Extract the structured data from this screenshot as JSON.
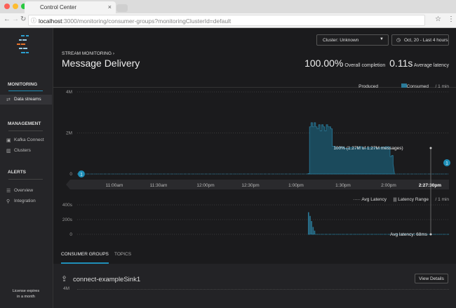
{
  "browser": {
    "tab_title": "Control Center",
    "url_host": "localhost",
    "url_rest": ":3000/monitoring/consumer-groups?monitoringClusterId=default"
  },
  "sidebar": {
    "sections": [
      {
        "title": "MONITORING",
        "items": [
          {
            "label": "Data streams",
            "icon": "data-streams-icon",
            "active": true
          }
        ]
      },
      {
        "title": "MANAGEMENT",
        "items": [
          {
            "label": "Kafka Connect",
            "icon": "kafka-connect-icon"
          },
          {
            "label": "Clusters",
            "icon": "clusters-icon"
          }
        ]
      },
      {
        "title": "ALERTS",
        "items": [
          {
            "label": "Overview",
            "icon": "list-icon"
          },
          {
            "label": "Integration",
            "icon": "integration-icon"
          }
        ]
      }
    ],
    "license_line1": "License expires",
    "license_line2": "in a month"
  },
  "header": {
    "cluster_select": "Cluster: Unknown",
    "time_range": "Oct, 20 - Last 4 hours",
    "breadcrumb": "STREAM MONITORING",
    "title": "Message Delivery",
    "completion_value": "100.00%",
    "completion_label": "Overall completion",
    "latency_value": "0.11s",
    "latency_label": "Average latency"
  },
  "colors": {
    "accent": "#1f8fb8",
    "area": "#1b4a5c",
    "sidebar": "#252528",
    "bg": "#1b1b1d"
  },
  "chart_data": [
    {
      "type": "area",
      "legend": [
        "Produced",
        "Consumed"
      ],
      "interval": "/ 1 min",
      "yticks": [
        "4M",
        "2M",
        "0"
      ],
      "ylim": [
        0,
        4000000
      ],
      "xticks": [
        "11:00am",
        "11:30am",
        "12:00pm",
        "12:30pm",
        "1:00pm",
        "1:30pm",
        "2:00pm",
        "2:27:30pm"
      ],
      "annotation": "100% (1.27M of 1.27M messages)",
      "markers": [
        "1",
        "1"
      ],
      "x": [
        "13:42",
        "13:43",
        "13:44",
        "13:45",
        "13:46",
        "13:47",
        "13:48",
        "13:49",
        "13:50",
        "13:51",
        "13:52",
        "13:53",
        "13:54",
        "13:55",
        "13:56",
        "13:57",
        "13:58",
        "14:00",
        "14:03",
        "14:06",
        "14:09",
        "14:12",
        "14:15",
        "14:18",
        "14:21",
        "14:24",
        "14:27",
        "14:30",
        "14:33",
        "14:35",
        "14:36",
        "14:37",
        "14:38"
      ],
      "consumed": [
        20000,
        2300000,
        2500000,
        2300000,
        2500000,
        2300000,
        2200000,
        2400000,
        2100000,
        2400000,
        2300000,
        2100000,
        2400000,
        2300000,
        2300000,
        2200000,
        1350000,
        1280000,
        1320000,
        1250000,
        1300000,
        1270000,
        1330000,
        1260000,
        1300000,
        1280000,
        1270000,
        1310000,
        1330000,
        1320000,
        850000,
        900000,
        500000
      ]
    },
    {
      "type": "area",
      "legend": [
        "Avg Latency",
        "Latency Range"
      ],
      "interval": "/ 1 min",
      "yticks": [
        "400s",
        "200s",
        "0"
      ],
      "ylim": [
        0,
        400
      ],
      "annotation": "Avg latency: 68ms",
      "x": [
        "13:42",
        "13:43",
        "13:44",
        "13:45",
        "13:46",
        "13:47",
        "14:38"
      ],
      "latency": [
        300,
        250,
        180,
        100,
        50,
        0.068,
        0.068
      ]
    }
  ],
  "tabs": [
    {
      "label": "CONSUMER GROUPS",
      "active": true
    },
    {
      "label": "TOPICS"
    }
  ],
  "consumer": {
    "name": "connect-exampleSink1",
    "button": "View Details",
    "ytick": "4M"
  }
}
